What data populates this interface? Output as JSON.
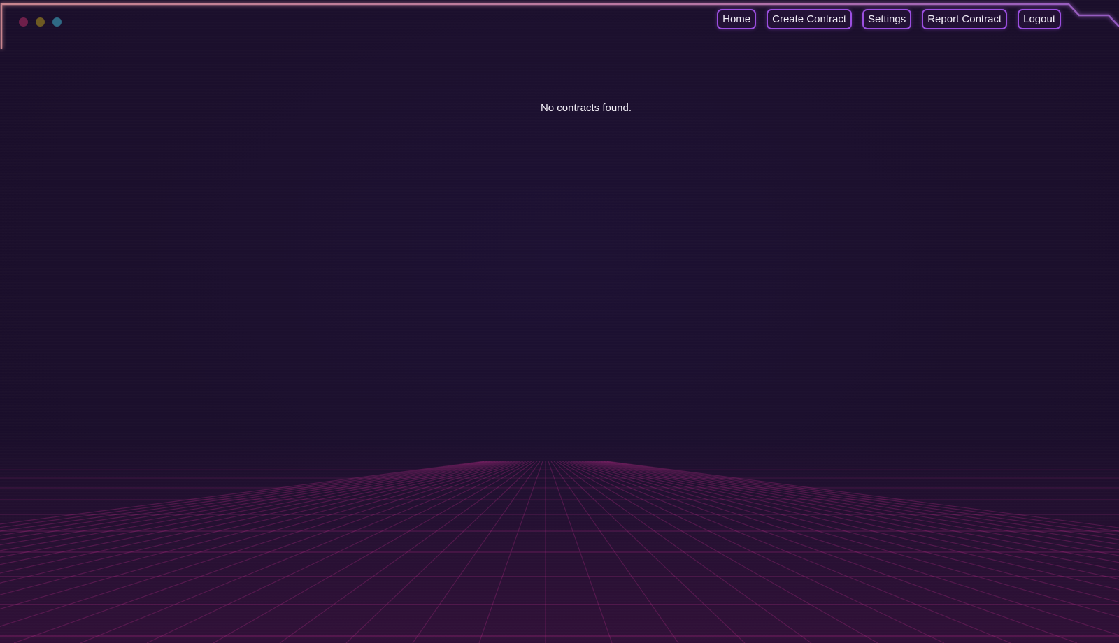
{
  "window": {
    "traffic_lights": [
      {
        "name": "close",
        "color": "#6e1f4a"
      },
      {
        "name": "minimize",
        "color": "#6e5a22"
      },
      {
        "name": "zoom",
        "color": "#2f6a85"
      }
    ]
  },
  "nav": {
    "items": [
      {
        "label": "Home"
      },
      {
        "label": "Create Contract"
      },
      {
        "label": "Settings"
      },
      {
        "label": "Report Contract"
      },
      {
        "label": "Logout"
      }
    ]
  },
  "main": {
    "empty_message": "No contracts found."
  },
  "theme": {
    "background": "#1c0f2e",
    "accent": "#9b4fe0",
    "frame_top": "#e08a9a",
    "frame_right": "#b06ad8",
    "frame_left": "#f0b87a",
    "grid": "#c02c8c"
  }
}
